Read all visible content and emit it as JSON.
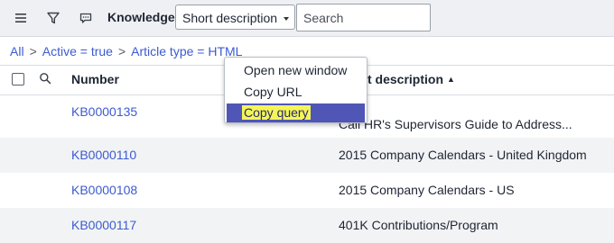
{
  "header": {
    "menu_icon": "hamburger-menu-icon",
    "filter_icon": "funnel-icon",
    "chat_icon": "chat-bubble-icon",
    "title": "Knowledge",
    "field_select": "Short description",
    "search_placeholder": "Search"
  },
  "breadcrumb": {
    "items": [
      "All",
      "Active = true",
      "Article type = HTML"
    ],
    "separator": ">"
  },
  "columns": {
    "number": "Number",
    "short_description": "Short description",
    "short_description_visible": "t description",
    "sort_indicator": "▲"
  },
  "rows": [
    {
      "number": "KB0000135",
      "description": "Call HR's Supervisors Guide to Address..."
    },
    {
      "number": "KB0000110",
      "description": "2015 Company Calendars - United Kingdom"
    },
    {
      "number": "KB0000108",
      "description": "2015 Company Calendars - US"
    },
    {
      "number": "KB0000117",
      "description": "401K Contributions/Program"
    }
  ],
  "context_menu": {
    "items": [
      "Open new window",
      "Copy URL",
      "Copy query"
    ],
    "selected": "Copy query"
  },
  "colors": {
    "link": "#3c5bd0",
    "header_bg": "#eef0f3",
    "menu_selected_bg": "#4f56b5",
    "highlight": "#f3f55a"
  }
}
